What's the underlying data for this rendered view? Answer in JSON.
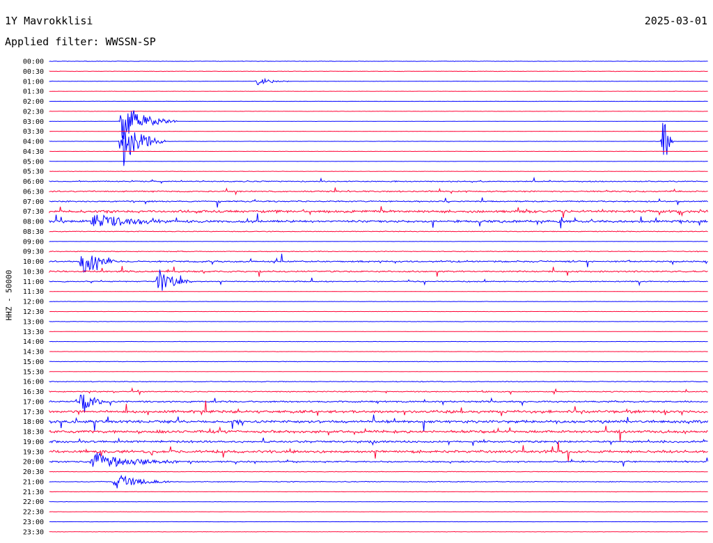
{
  "header": {
    "station": "1Y Mavrokklisi",
    "date": "2025-03-01",
    "filter": "Applied filter: WWSSN-SP"
  },
  "side_label": "HHZ - 50000",
  "colors": {
    "even_row": "#0000ff",
    "odd_row": "#ff0033",
    "text": "#000000",
    "background": "#ffffff"
  },
  "chart_data": {
    "type": "line",
    "title": "1Y Mavrokklisi",
    "subtitle": "Applied filter: WWSSN-SP",
    "date": "2025-03-01",
    "ylabel": "HHZ - 50000",
    "xlabel": "",
    "y_tick_labels": [
      "00:00",
      "00:30",
      "01:00",
      "01:30",
      "02:00",
      "02:30",
      "03:00",
      "03:30",
      "04:00",
      "04:30",
      "05:00",
      "05:30",
      "06:00",
      "06:30",
      "07:00",
      "07:30",
      "08:00",
      "08:30",
      "09:00",
      "09:30",
      "10:00",
      "10:30",
      "11:00",
      "11:30",
      "12:00",
      "12:30",
      "13:00",
      "13:30",
      "14:00",
      "14:30",
      "15:00",
      "15:30",
      "16:00",
      "16:30",
      "17:00",
      "17:30",
      "18:00",
      "18:30",
      "19:00",
      "19:30",
      "20:00",
      "20:30",
      "21:00",
      "21:30",
      "22:00",
      "22:30",
      "23:00",
      "23:30"
    ],
    "row_noise_level": [
      0.15,
      0.15,
      0.15,
      0.1,
      0.1,
      0.1,
      0.1,
      0.1,
      0.1,
      0.1,
      0.1,
      0.15,
      0.4,
      0.5,
      0.5,
      1.0,
      0.9,
      0.3,
      0.1,
      0.3,
      0.6,
      0.6,
      0.4,
      0.1,
      0.15,
      0.1,
      0.15,
      0.1,
      0.15,
      0.1,
      0.2,
      0.1,
      0.3,
      0.4,
      0.6,
      1.0,
      1.0,
      1.0,
      0.8,
      1.0,
      0.6,
      0.2,
      0.3,
      0.15,
      0.15,
      0.1,
      0.1,
      0.15
    ],
    "events": [
      {
        "row": 2,
        "minute": 9.5,
        "amplitude": 6,
        "duration": 1.5
      },
      {
        "row": 6,
        "minute": 3.3,
        "amplitude": 30,
        "duration": 2.5
      },
      {
        "row": 8,
        "minute": 3.3,
        "amplitude": 40,
        "duration": 2.0
      },
      {
        "row": 8,
        "minute": 28,
        "amplitude": 50,
        "duration": 0.4
      },
      {
        "row": 16,
        "minute": 2,
        "amplitude": 12,
        "duration": 3.5
      },
      {
        "row": 20,
        "minute": 1.5,
        "amplitude": 20,
        "duration": 1.5
      },
      {
        "row": 22,
        "minute": 5,
        "amplitude": 20,
        "duration": 1.5
      },
      {
        "row": 34,
        "minute": 1.5,
        "amplitude": 25,
        "duration": 1.0
      },
      {
        "row": 40,
        "minute": 2,
        "amplitude": 14,
        "duration": 4.0
      },
      {
        "row": 42,
        "minute": 3,
        "amplitude": 12,
        "duration": 2.5
      }
    ]
  }
}
